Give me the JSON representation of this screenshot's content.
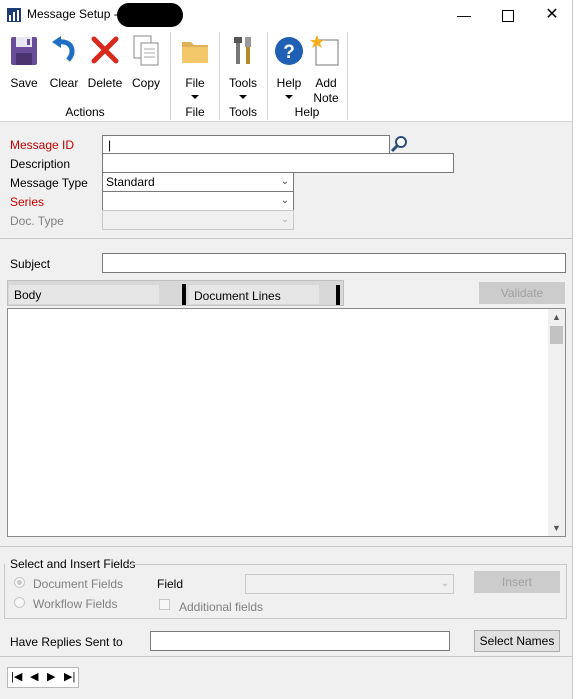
{
  "window": {
    "title": "Message Setup  -"
  },
  "ribbon": {
    "buttons": {
      "save": "Save",
      "clear": "Clear",
      "delete": "Delete",
      "copy": "Copy",
      "file": "File",
      "tools": "Tools",
      "help": "Help",
      "add_note_1": "Add",
      "add_note_2": "Note"
    },
    "groups": {
      "actions": "Actions",
      "file": "File",
      "tools": "Tools",
      "help": "Help"
    }
  },
  "form": {
    "message_id_label": "Message ID",
    "message_id_value": "|",
    "description_label": "Description",
    "description_value": "",
    "message_type_label": "Message Type",
    "message_type_value": "Standard",
    "series_label": "Series",
    "series_value": "",
    "doc_type_label": "Doc. Type",
    "doc_type_value": "",
    "subject_label": "Subject",
    "subject_value": "",
    "tabs": {
      "body": "Body",
      "document_lines": "Document Lines"
    },
    "validate_label": "Validate",
    "body_text": ""
  },
  "insert_fields": {
    "section_label": "Select and Insert Fields",
    "document_fields": "Document Fields",
    "workflow_fields": "Workflow Fields",
    "field_label": "Field",
    "field_value": "",
    "additional_fields": "Additional fields",
    "insert_label": "Insert"
  },
  "replies": {
    "label": "Have Replies Sent to",
    "value": "",
    "select_names": "Select Names"
  },
  "colors": {
    "required": "#c00000",
    "help_blue": "#1f5fb4",
    "accent_red": "#d9291c"
  }
}
